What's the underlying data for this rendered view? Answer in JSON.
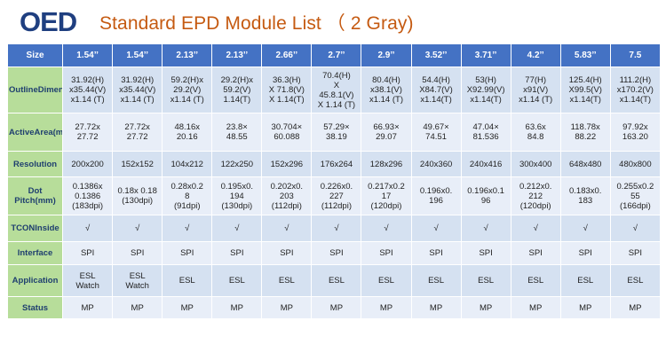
{
  "header": {
    "logo_text": "OED",
    "title": "Standard EPD Module List （ 2 Gray)"
  },
  "table": {
    "corner_label": "Size",
    "columns": [
      "1.54’’",
      "1.54’’",
      "2.13’’",
      "2.13’’",
      "2.66’’",
      "2.7’’",
      "2.9’’",
      "3.52’’",
      "3.71’’",
      "4.2’’",
      "5.83’’",
      "7.5"
    ],
    "rows": [
      {
        "label": [
          "Outline",
          "Dimension",
          "(mm)"
        ],
        "cells": [
          [
            "31.92(H)",
            "x35.44(V)",
            "x1.14 (T)"
          ],
          [
            "31.92(H)",
            "x35.44(V)",
            "x1.14 (T)"
          ],
          [
            "59.2(H)x",
            "29.2(V)",
            "x1.14 (T)"
          ],
          [
            "29.2(H)x",
            "59.2(V)",
            "1.14(T)"
          ],
          [
            "36.3(H)",
            "X 71.8(V)",
            "X 1.14(T)"
          ],
          [
            "70.4(H)",
            "X",
            "45.8.1(V)",
            "X 1.14 (T)"
          ],
          [
            "80.4(H)",
            "x38.1(V)",
            "x1.14 (T)"
          ],
          [
            "54.4(H)",
            "X84.7(V)",
            "x1.14(T)"
          ],
          [
            "53(H)",
            "X92.99(V)",
            "x1.14(T)"
          ],
          [
            "77(H)",
            "x91(V)",
            "x1.14 (T)"
          ],
          [
            "125.4(H)",
            "X99.5(V)",
            "x1.14(T)"
          ],
          [
            "111.2(H)",
            "x170.2(V)",
            "x1.14(T)"
          ]
        ]
      },
      {
        "label": [
          "Active",
          "Area",
          "(mm)"
        ],
        "cells": [
          [
            "27.72x",
            "27.72"
          ],
          [
            "27.72x",
            "27.72"
          ],
          [
            "48.16x",
            "20.16"
          ],
          [
            "23.8×",
            "48.55"
          ],
          [
            "30.704×",
            "60.088"
          ],
          [
            "57.29×",
            "38.19"
          ],
          [
            "66.93×",
            "29.07"
          ],
          [
            "49.67×",
            "74.51"
          ],
          [
            "47.04×",
            "81.536"
          ],
          [
            "63.6x",
            "84.8"
          ],
          [
            "118.78x",
            "88.22"
          ],
          [
            "97.92x",
            "163.20"
          ]
        ]
      },
      {
        "label": [
          "Resolution"
        ],
        "cells": [
          [
            "200x200"
          ],
          [
            "152x152"
          ],
          [
            "104x212"
          ],
          [
            "122x250"
          ],
          [
            "152x296"
          ],
          [
            "176x264"
          ],
          [
            "128x296"
          ],
          [
            "240x360"
          ],
          [
            "240x416"
          ],
          [
            "300x400"
          ],
          [
            "648x480"
          ],
          [
            "480x800"
          ]
        ]
      },
      {
        "label": [
          "Dot Pitch",
          "(mm)"
        ],
        "cells": [
          [
            "0.1386x",
            "0.1386",
            "(183dpi)"
          ],
          [
            "0.18x 0.18",
            "(130dpi)"
          ],
          [
            "0.28x0.2",
            "8",
            "(91dpi)"
          ],
          [
            "0.195x0.",
            "194",
            "(130dpi)"
          ],
          [
            "0.202x0.",
            "203",
            "(112dpi)"
          ],
          [
            "0.226x0.",
            "227",
            "(112dpi)"
          ],
          [
            "0.217x0.2",
            "17",
            "(120dpi)"
          ],
          [
            "0.196x0.",
            "196"
          ],
          [
            "0.196x0.1",
            "96"
          ],
          [
            "0.212x0.",
            "212",
            "(120dpi)"
          ],
          [
            "0.183x0.",
            "183"
          ],
          [
            "0.255x0.2",
            "55",
            "(166dpi)"
          ]
        ]
      },
      {
        "label": [
          "TCON",
          "Inside"
        ],
        "cells": [
          [
            "√"
          ],
          [
            "√"
          ],
          [
            "√"
          ],
          [
            "√"
          ],
          [
            "√"
          ],
          [
            "√"
          ],
          [
            "√"
          ],
          [
            "√"
          ],
          [
            "√"
          ],
          [
            "√"
          ],
          [
            "√"
          ],
          [
            "√"
          ]
        ]
      },
      {
        "label": [
          "Interface"
        ],
        "cells": [
          [
            "SPI"
          ],
          [
            "SPI"
          ],
          [
            "SPI"
          ],
          [
            "SPI"
          ],
          [
            "SPI"
          ],
          [
            "SPI"
          ],
          [
            "SPI"
          ],
          [
            "SPI"
          ],
          [
            "SPI"
          ],
          [
            "SPI"
          ],
          [
            "SPI"
          ],
          [
            "SPI"
          ]
        ]
      },
      {
        "label": [
          "Applicatio",
          "n"
        ],
        "cells": [
          [
            "ESL",
            "Watch"
          ],
          [
            "ESL",
            "Watch"
          ],
          [
            "ESL"
          ],
          [
            "ESL"
          ],
          [
            "ESL"
          ],
          [
            "ESL"
          ],
          [
            "ESL"
          ],
          [
            "ESL"
          ],
          [
            "ESL"
          ],
          [
            "ESL"
          ],
          [
            "ESL"
          ],
          [
            "ESL"
          ]
        ]
      },
      {
        "label": [
          "Status"
        ],
        "cells": [
          [
            "MP"
          ],
          [
            "MP"
          ],
          [
            "MP"
          ],
          [
            "MP"
          ],
          [
            "MP"
          ],
          [
            "MP"
          ],
          [
            "MP"
          ],
          [
            "MP"
          ],
          [
            "MP"
          ],
          [
            "MP"
          ],
          [
            "MP"
          ],
          [
            "MP"
          ]
        ]
      }
    ]
  },
  "colors": {
    "title": "#c55a11",
    "logo": "#1f3f80",
    "header_row": "#4472c4",
    "label_column": "#b7dd9a",
    "cell_even": "#d5e1f1",
    "cell_odd": "#e8eef8"
  }
}
